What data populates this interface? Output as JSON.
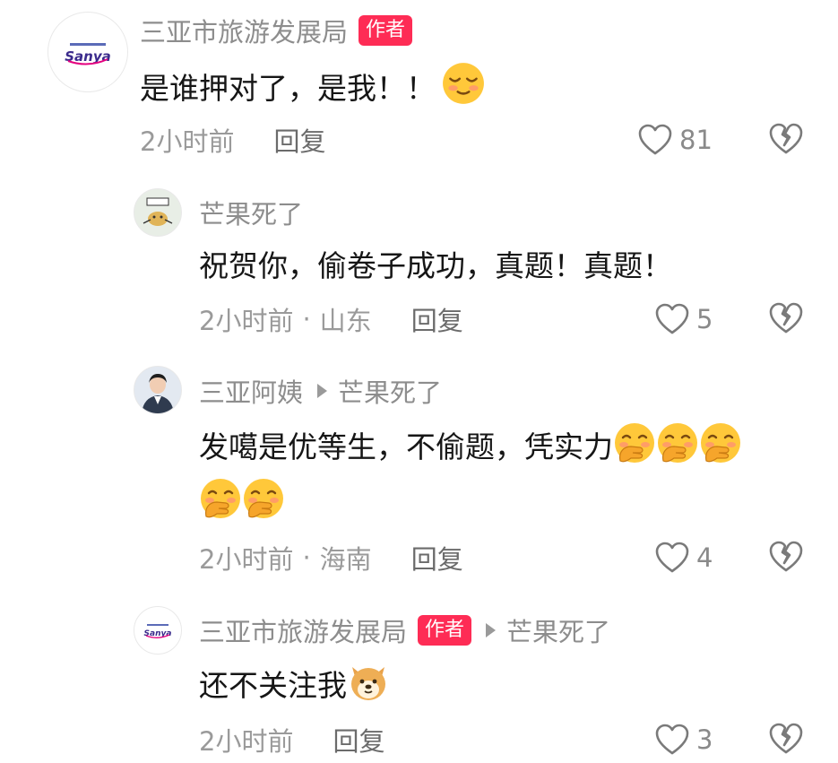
{
  "comments": [
    {
      "author": "三亚市旅游发展局",
      "badge": "作者",
      "avatar_logo": "Sanya",
      "text": "是谁押对了，是我！！",
      "time": "2小时前",
      "reply_label": "回复",
      "likes": "81",
      "emoji": "smiling-face-icon"
    },
    {
      "author": "芒果死了",
      "text": "祝贺你，偷卷子成功，真题！真题！",
      "time": "2小时前",
      "location": "山东",
      "reply_label": "回复",
      "likes": "5"
    },
    {
      "author": "三亚阿姨",
      "reply_to": "芒果死了",
      "text_line1": "发噶是优等生，不偷题，凭实力",
      "time": "2小时前",
      "location": "海南",
      "reply_label": "回复",
      "likes": "4",
      "emoji": "hand-over-mouth-icon"
    },
    {
      "author": "三亚市旅游发展局",
      "badge": "作者",
      "avatar_logo": "Sanya",
      "reply_to": "芒果死了",
      "text": "还不关注我",
      "time": "2小时前",
      "reply_label": "回复",
      "likes": "3",
      "emoji": "dog-face-icon"
    }
  ],
  "colors": {
    "badge": "#fe2c55",
    "meta": "#9a9a9a",
    "name": "#8d8d8d",
    "text": "#161616"
  }
}
